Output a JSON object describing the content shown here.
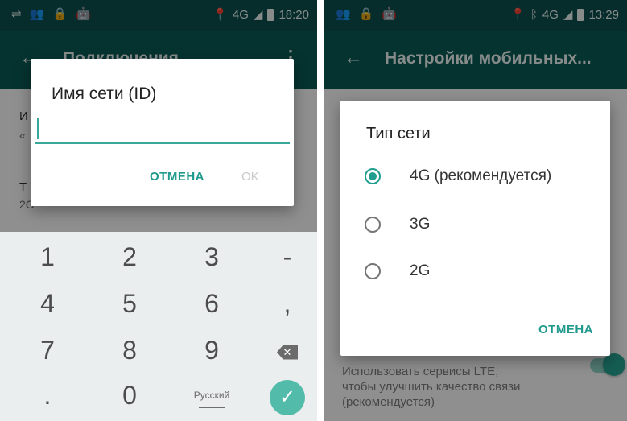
{
  "left": {
    "status_bar": {
      "left_icons": [
        "usb-icon",
        "people-icon",
        "lock-icon",
        "android-icon"
      ],
      "network": "4G",
      "time": "18:20"
    },
    "app_bar": {
      "back_icon": "arrow-left-icon",
      "title": "Подключения",
      "menu_icon": "more-vert-icon"
    },
    "background_rows": [
      {
        "line1": "И",
        "line2": "«"
      },
      {
        "line1": "Т",
        "line2": "2G"
      }
    ],
    "dialog": {
      "title": "Имя сети (ID)",
      "input_value": "",
      "cancel_label": "ОТМЕНА",
      "ok_label": "OK"
    },
    "keyboard": {
      "rows": [
        [
          "1",
          "2",
          "3",
          "-"
        ],
        [
          "4",
          "5",
          "6",
          ","
        ],
        [
          "7",
          "8",
          "9",
          "⌫"
        ],
        [
          ".",
          "0",
          "Русский",
          "✓"
        ]
      ],
      "language": "Русский"
    }
  },
  "right": {
    "status_bar": {
      "left_icons": [
        "people-icon",
        "lock-icon",
        "android-icon"
      ],
      "network": "4G",
      "time": "13:29"
    },
    "app_bar": {
      "back_icon": "arrow-left-icon",
      "title": "Настройки мобильных..."
    },
    "dialog": {
      "title": "Тип сети",
      "options": [
        {
          "label": "4G (рекомендуется)",
          "selected": true
        },
        {
          "label": "3G",
          "selected": false
        },
        {
          "label": "2G",
          "selected": false
        }
      ],
      "cancel_label": "ОТМЕНА"
    },
    "below_setting": {
      "text_line1": "Использовать сервисы LTE,",
      "text_line2": "чтобы улучшить качество связи",
      "text_line3": "(рекомендуется)",
      "toggle_on": true
    }
  },
  "colors": {
    "status_bar": "#0b4f4b",
    "app_bar": "#0a5954",
    "accent": "#209a8d",
    "enter_button": "#52bba9"
  }
}
